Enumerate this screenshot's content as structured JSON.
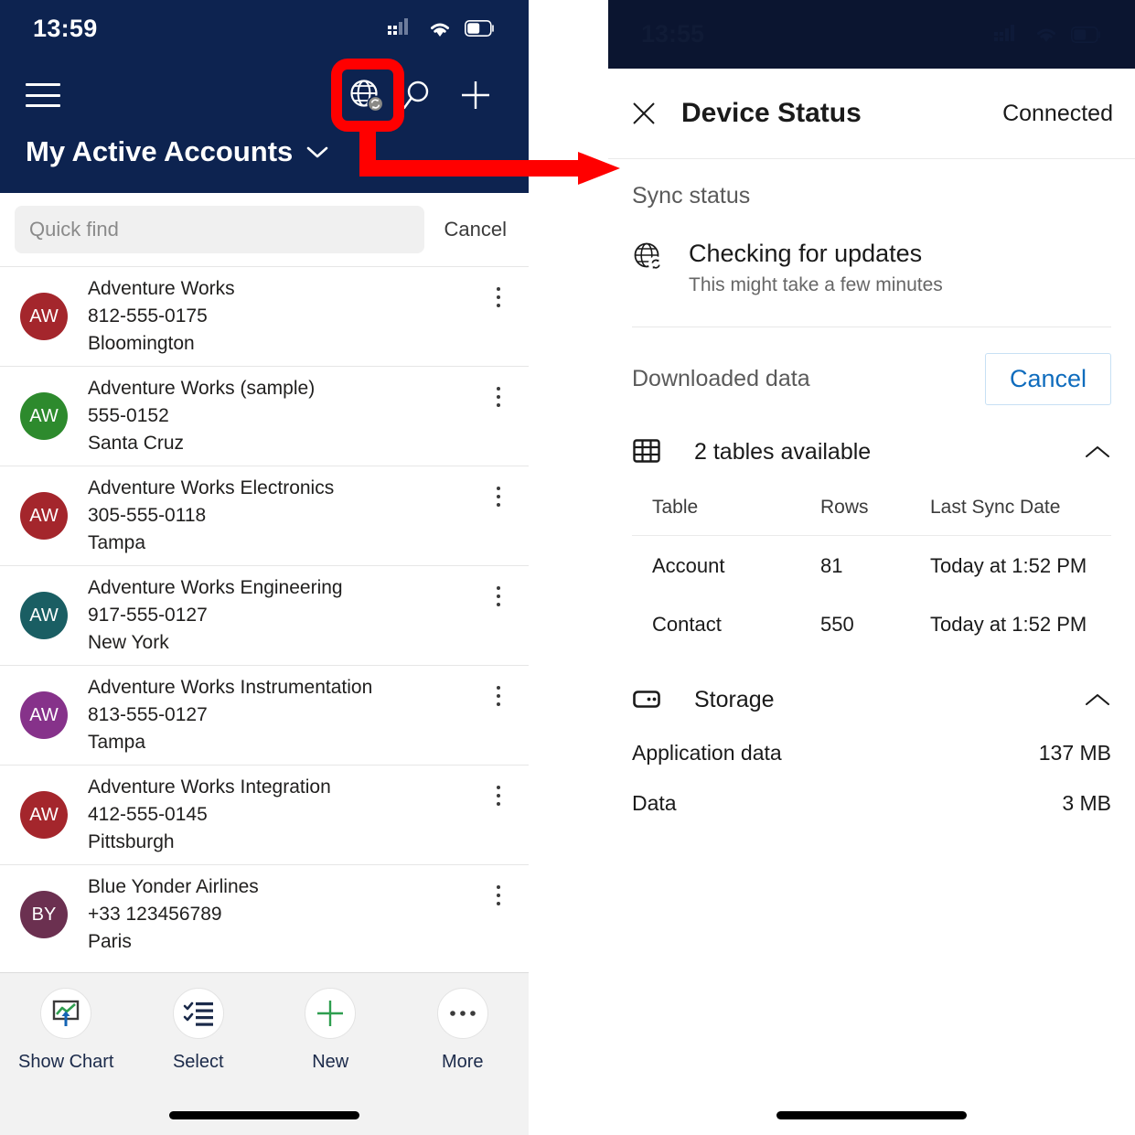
{
  "left_phone": {
    "status_bar": {
      "time": "13:59",
      "signal_icon": "signal-bars-icon",
      "wifi_icon": "wifi-icon",
      "battery_icon": "battery-icon"
    },
    "nav": {
      "menu_icon": "hamburger-menu-icon",
      "sync_icon": "globe-sync-icon",
      "search_icon": "search-icon",
      "new_icon": "plus-icon"
    },
    "view_title": "My Active Accounts",
    "view_title_chevron": "chevron-down-icon",
    "search": {
      "placeholder": "Quick find",
      "value": "",
      "cancel_label": "Cancel"
    },
    "accounts": [
      {
        "initials": "AW",
        "color": "#A4262C",
        "name": "Adventure Works",
        "phone": "812-555-0175",
        "city": "Bloomington"
      },
      {
        "initials": "AW",
        "color": "#2D8A2D",
        "name": "Adventure Works (sample)",
        "phone": "555-0152",
        "city": "Santa Cruz"
      },
      {
        "initials": "AW",
        "color": "#A4262C",
        "name": "Adventure Works Electronics",
        "phone": "305-555-0118",
        "city": "Tampa"
      },
      {
        "initials": "AW",
        "color": "#1A5E63",
        "name": "Adventure Works Engineering",
        "phone": "917-555-0127",
        "city": "New York"
      },
      {
        "initials": "AW",
        "color": "#86328A",
        "name": "Adventure Works Instrumentation",
        "phone": "813-555-0127",
        "city": "Tampa"
      },
      {
        "initials": "AW",
        "color": "#A4262C",
        "name": "Adventure Works Integration",
        "phone": "412-555-0145",
        "city": "Pittsburgh"
      },
      {
        "initials": "BY",
        "color": "#6B3050",
        "name": "Blue Yonder Airlines",
        "phone": "+33 123456789",
        "city": "Paris"
      }
    ],
    "bottom_bar": [
      {
        "label": "Show Chart",
        "icon": "show-chart-icon"
      },
      {
        "label": "Select",
        "icon": "checklist-select-icon"
      },
      {
        "label": "New",
        "icon": "plus-icon"
      },
      {
        "label": "More",
        "icon": "ellipsis-icon"
      }
    ]
  },
  "right_phone": {
    "status_bar": {
      "time": "13:55",
      "signal_icon": "signal-bars-icon",
      "wifi_icon": "wifi-icon",
      "battery_icon": "battery-icon"
    },
    "header": {
      "close_icon": "close-x-icon",
      "title": "Device Status",
      "connection_status": "Connected"
    },
    "sync_section": {
      "heading": "Sync status",
      "icon": "globe-sync-icon",
      "title": "Checking for updates",
      "subtitle": "This might take a few minutes"
    },
    "downloaded": {
      "heading": "Downloaded data",
      "cancel_label": "Cancel",
      "tables_group": {
        "icon": "table-grid-icon",
        "label": "2 tables available",
        "chevron": "chevron-up-icon",
        "columns": [
          "Table",
          "Rows",
          "Last Sync Date"
        ],
        "rows": [
          {
            "table": "Account",
            "count": "81",
            "last_sync": "Today at 1:52 PM"
          },
          {
            "table": "Contact",
            "count": "550",
            "last_sync": "Today at 1:52 PM"
          }
        ]
      },
      "storage_group": {
        "icon": "storage-device-icon",
        "label": "Storage",
        "chevron": "chevron-up-icon",
        "items": [
          {
            "label": "Application data",
            "value": "137 MB"
          },
          {
            "label": "Data",
            "value": "3 MB"
          }
        ]
      }
    }
  },
  "annotation": {
    "highlight_target": "globe-sync-icon",
    "color": "#FF0000",
    "arrow_icon": "arrow-right-icon"
  }
}
